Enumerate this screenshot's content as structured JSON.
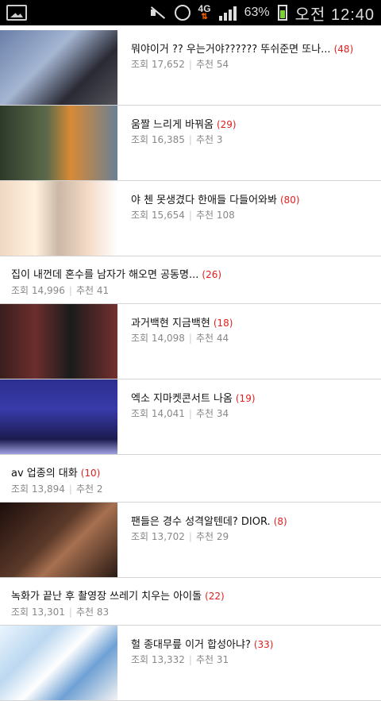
{
  "status_bar": {
    "network": "4G",
    "battery_pct": "63%",
    "time": "오전 12:40"
  },
  "labels": {
    "views": "조회",
    "recommend": "추천"
  },
  "posts": [
    {
      "type": "thumb",
      "thumb": "t1",
      "title": "뭐야이거 ?? 우는거야?????? 뚜쉬준면 또나...",
      "comments": "(48)",
      "views": "17,652",
      "recs": "54"
    },
    {
      "type": "thumb",
      "thumb": "t2",
      "title": "움짤 느리게 바꿔옴",
      "comments": "(29)",
      "views": "16,385",
      "recs": "3"
    },
    {
      "type": "thumb",
      "thumb": "t3",
      "title": "야 첸 못생겼다 한애들 다들어와봐",
      "comments": "(80)",
      "views": "15,654",
      "recs": "108"
    },
    {
      "type": "plain",
      "title": "집이 내껀데 혼수를 남자가 해오면 공동명...",
      "comments": "(26)",
      "views": "14,996",
      "recs": "41"
    },
    {
      "type": "thumb",
      "thumb": "t4",
      "title": "과거백현 지금백현",
      "comments": "(18)",
      "views": "14,098",
      "recs": "44"
    },
    {
      "type": "thumb",
      "thumb": "t5",
      "title": "엑소 지마켓콘서트 나옴",
      "comments": "(19)",
      "views": "14,041",
      "recs": "34"
    },
    {
      "type": "plain",
      "title": "av 업종의 대화",
      "comments": "(10)",
      "views": "13,894",
      "recs": "2"
    },
    {
      "type": "thumb",
      "thumb": "t6",
      "title": "팬들은 경수 성격알텐데? DIOR.",
      "comments": "(8)",
      "views": "13,702",
      "recs": "29"
    },
    {
      "type": "plain",
      "title": "녹화가 끝난 후 촬영장 쓰레기 치우는 아이돌",
      "comments": "(22)",
      "views": "13,301",
      "recs": "83"
    },
    {
      "type": "thumb",
      "thumb": "t7",
      "title": "헐 종대무릎 이거 합성아냐?",
      "comments": "(33)",
      "views": "13,332",
      "recs": "31"
    }
  ]
}
